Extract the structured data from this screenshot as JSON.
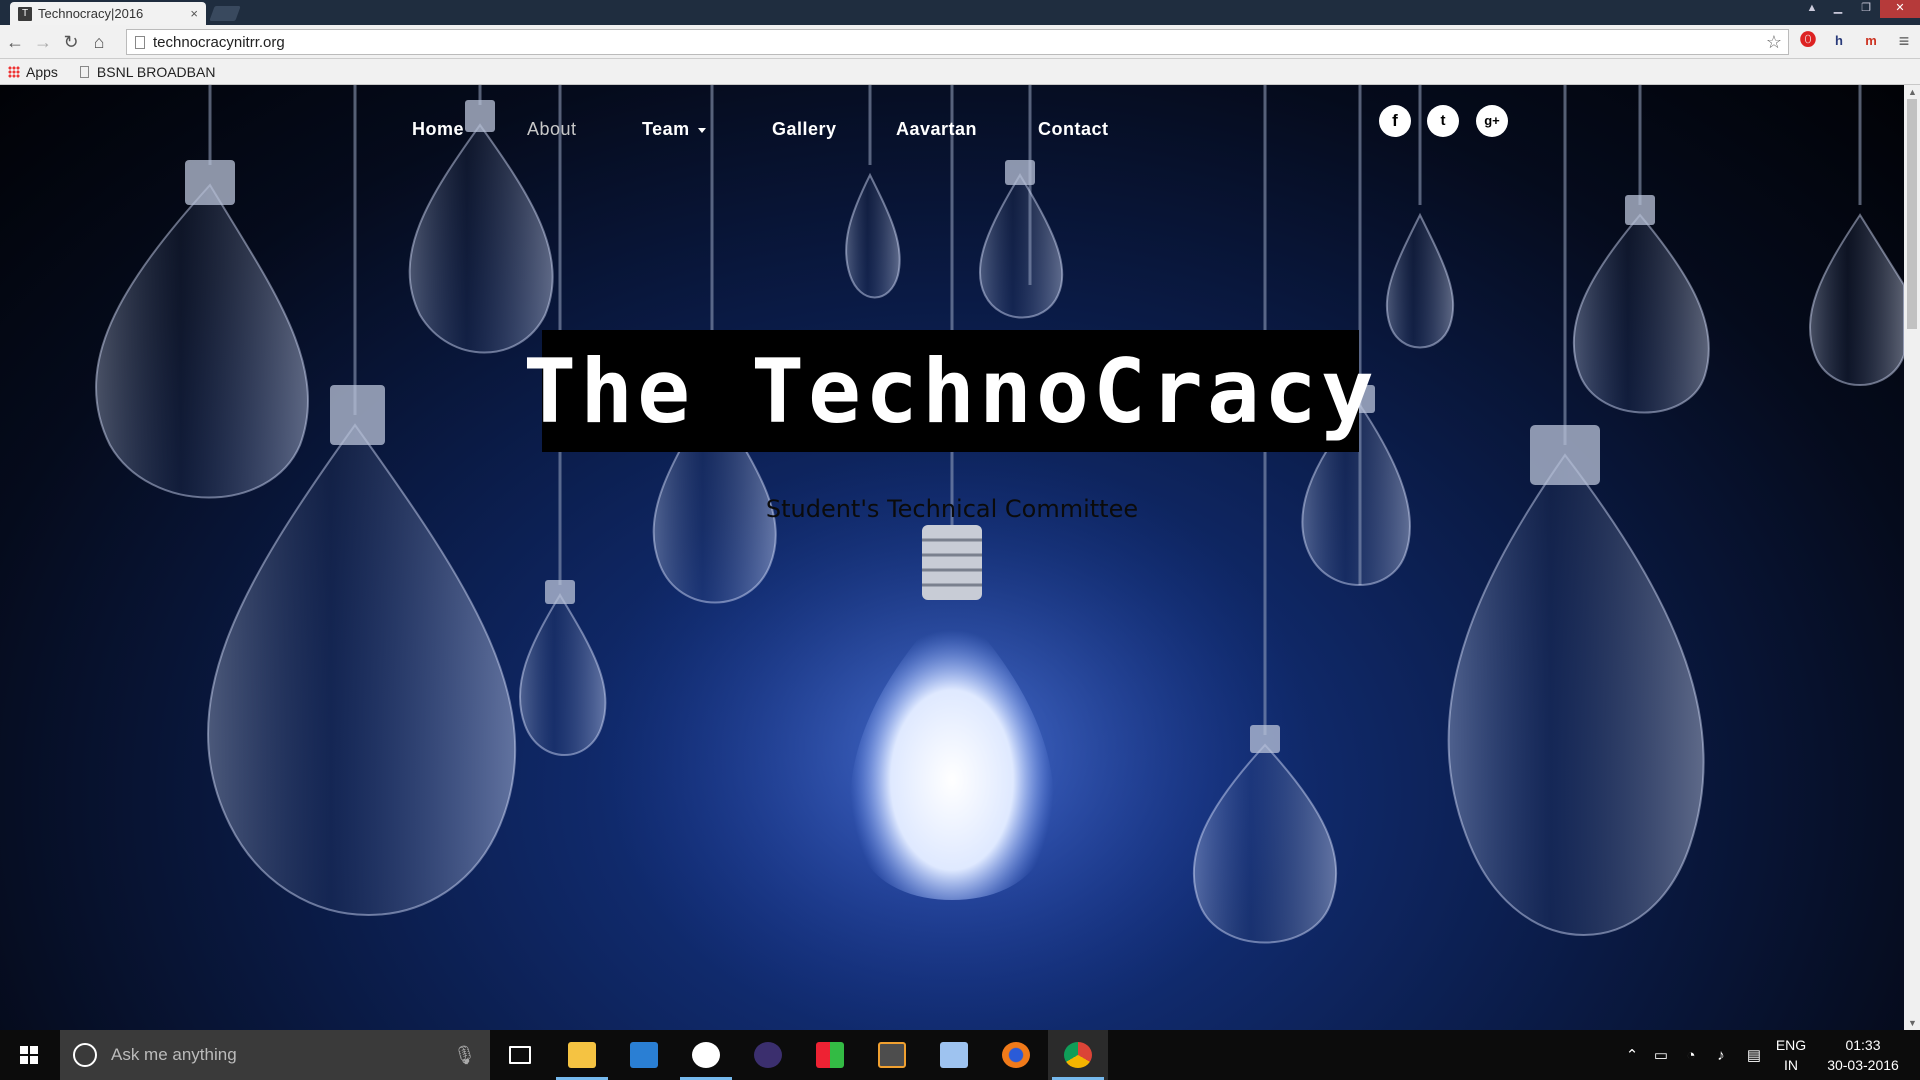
{
  "browser": {
    "tab_title": "Technocracy|2016",
    "tab_close": "×",
    "url": "technocracynitrr.org",
    "bookmarks": {
      "apps": "Apps",
      "bsnl": "BSNL BROADBAN"
    }
  },
  "site": {
    "nav": {
      "home": "Home",
      "about": "About",
      "team": "Team",
      "gallery": "Gallery",
      "aavartan": "Aavartan",
      "contact": "Contact"
    },
    "social": {
      "facebook": "f",
      "twitter": "t",
      "googleplus": "g+"
    },
    "hero_title": "The TechnoCracy",
    "tagline": "Student's Technical Committee"
  },
  "taskbar": {
    "search_placeholder": "Ask me anything",
    "lang_line1": "ENG",
    "lang_line2": "IN",
    "time": "01:33",
    "date": "30-03-2016"
  },
  "colors": {
    "accent": "#76b9ed",
    "page_bg": "#102a6c"
  }
}
